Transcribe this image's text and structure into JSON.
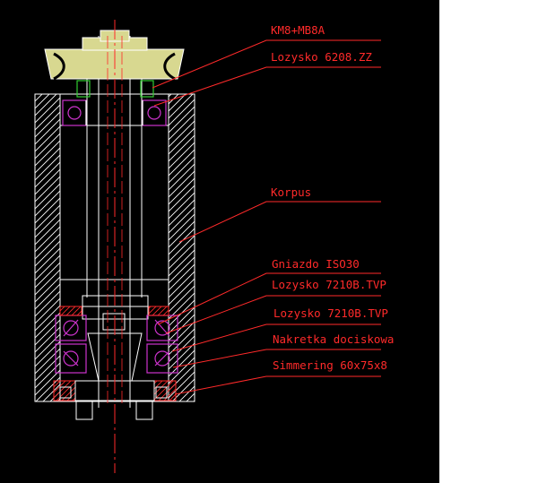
{
  "drawing": {
    "labels": [
      "KM8+MB8A",
      "Lozysko 6208.ZZ",
      "Korpus",
      "Gniazdo ISO30",
      "Lozysko 7210B.TVP",
      "Lozysko 7210B.TVP",
      "Nakretka dociskowa",
      "Simmering 60x75x8"
    ]
  },
  "colors": {
    "background": "#000000",
    "outline": "#ffffff",
    "annotation": "#ff2a2a",
    "bearing": "#cc33cc",
    "nut": "#33cc33",
    "pulley": "#d8d890"
  }
}
